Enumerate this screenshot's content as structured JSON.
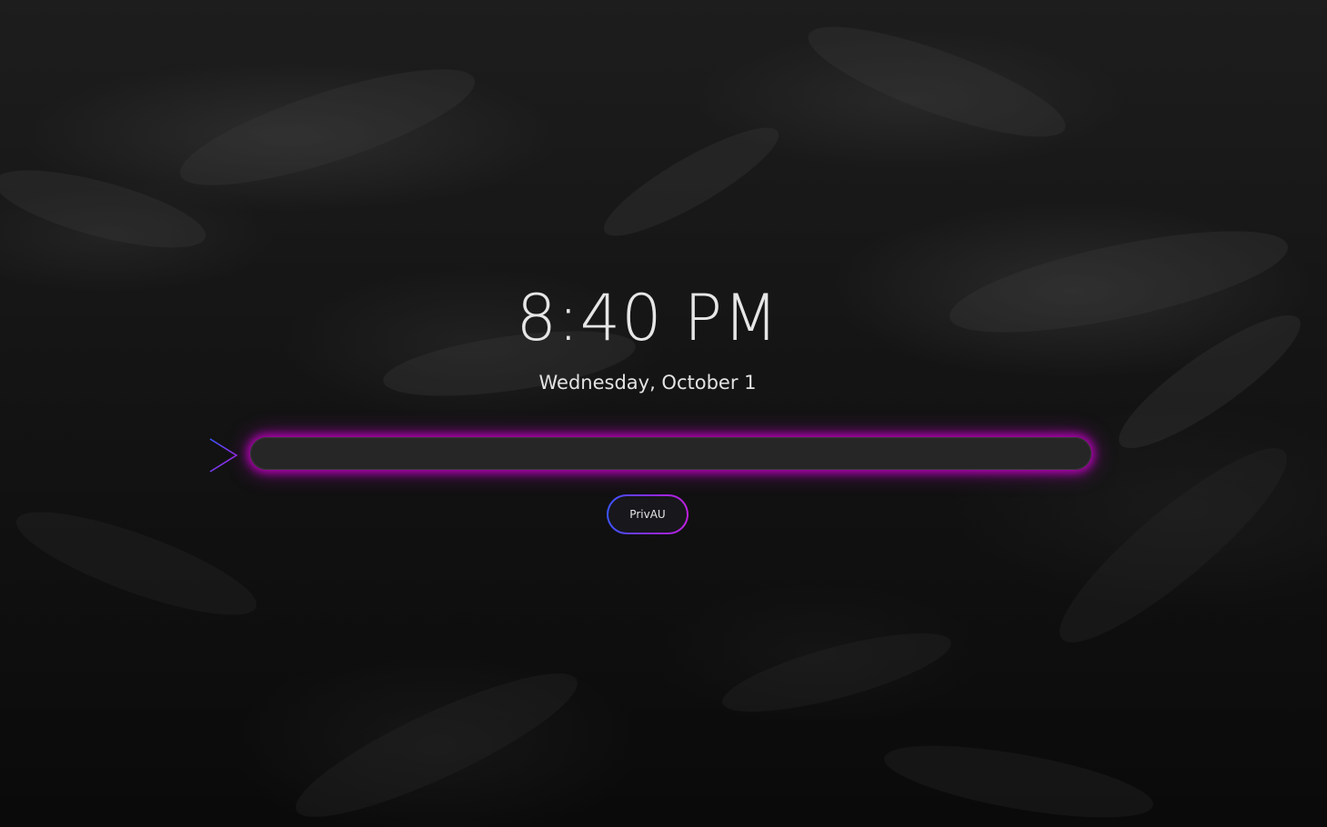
{
  "lockscreen": {
    "time": "8:40 PM",
    "date": "Wednesday, October 1",
    "password_field": {
      "value": "",
      "placeholder": ""
    },
    "user_button_label": "PrivAU"
  },
  "icons": {
    "prompt": "chevron-right-icon"
  },
  "colors": {
    "glow": "#cc00cc",
    "accent_start": "#3b55ff",
    "accent_end": "#c020e0",
    "text": "#e6e6e6"
  }
}
